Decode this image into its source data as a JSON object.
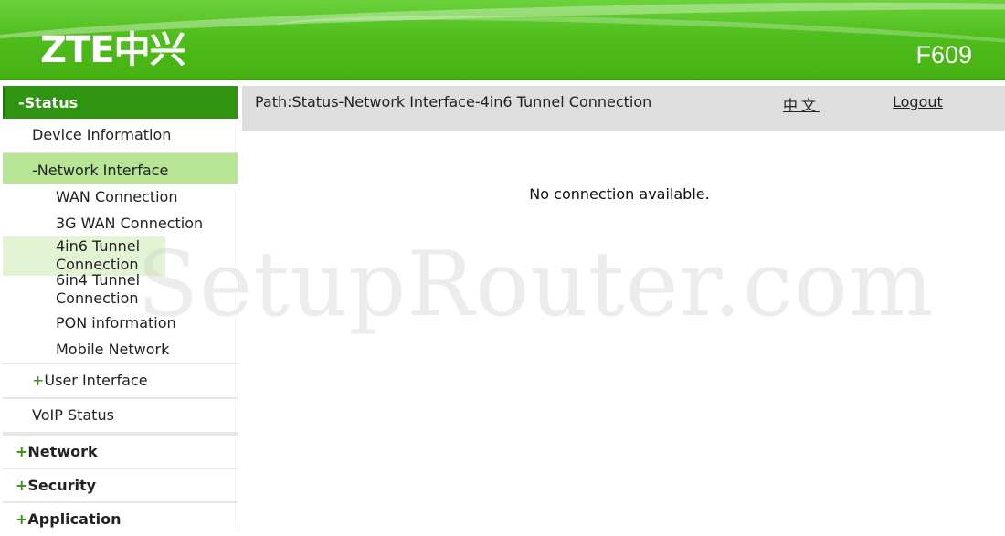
{
  "header": {
    "logo": "ZTE中兴",
    "model": "F609"
  },
  "sidebar": {
    "status_label": "-Status",
    "device_information": "Device Information",
    "network_interface": "-Network Interface",
    "network_children": [
      "WAN Connection",
      "3G WAN Connection",
      "4in6 Tunnel Connection",
      "6in4 Tunnel Connection",
      "PON information",
      "Mobile Network"
    ],
    "user_interface": "User Interface",
    "voip_status": "VoIP Status",
    "network": "Network",
    "security": "Security",
    "application": "Application",
    "plus_symbol": "+"
  },
  "path": {
    "text": "Path:Status-Network Interface-4in6 Tunnel Connection",
    "language_link": "中文",
    "logout_link": "Logout"
  },
  "main": {
    "message": "No connection available."
  },
  "watermark": "SetupRouter.com",
  "colors": {
    "brand_green": "#4fbe1c",
    "sidebar_header": "#2f9412",
    "active_item": "#b8e495",
    "path_bar": "#dedede"
  }
}
